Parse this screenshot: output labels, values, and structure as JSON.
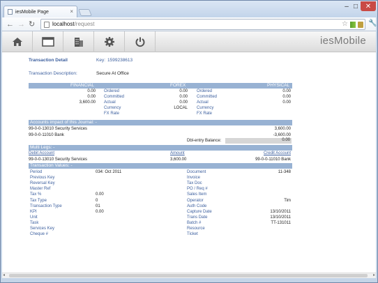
{
  "browser": {
    "tab_title": "iesMobile Page",
    "url_host": "localhost",
    "url_path": "/request"
  },
  "app": {
    "brand": "iesMobile",
    "toolbar_icons": [
      "home-icon",
      "window-icon",
      "building-icon",
      "gear-icon",
      "power-icon"
    ]
  },
  "transaction": {
    "detail_label": "Transaction Detail",
    "key_label": "Key:",
    "key_value": "1599238613",
    "desc_label": "Transaction Description:",
    "desc_value": "Secure At Office"
  },
  "currency_table": {
    "headers": [
      "FINANCIAL",
      "FOREX",
      "PHYSICAL"
    ],
    "rows": [
      {
        "fin_value": "0.00",
        "fin_label": "Ordered",
        "fx_value": "0.00",
        "fx_label": "Ordered",
        "phys_value": "0.00"
      },
      {
        "fin_value": "0.00",
        "fin_label": "Committed",
        "fx_value": "0.00",
        "fx_label": "Committed",
        "phys_value": "0.00"
      },
      {
        "fin_value": "3,600.00",
        "fin_label": "Actual",
        "fx_value": "0.00",
        "fx_label": "Actual",
        "phys_value": "0.00"
      },
      {
        "fin_value": "",
        "fin_label": "Currency",
        "fx_value": "LOCAL",
        "fx_label": "Currency",
        "phys_value": ""
      },
      {
        "fin_value": "",
        "fin_label": "FX Rate",
        "fx_value": "",
        "fx_label": "FX Rate",
        "phys_value": ""
      }
    ]
  },
  "accounts_impact": {
    "header": "Accounts impact of this Journal: -",
    "rows": [
      {
        "account": "99-0-0-13010 Security Services",
        "amount": "3,600.00"
      },
      {
        "account": "99-0-0-11010 Bank",
        "amount": "-3,600.00"
      }
    ],
    "dbl_label": "Dbl-entry Balance:",
    "dbl_value": "0.00"
  },
  "multi_legs": {
    "header": "Multi Legs: -",
    "columns": [
      "Debit Account",
      "Amount",
      "Credit Account"
    ],
    "rows": [
      {
        "debit": "99-0-0-13010 Security Services",
        "amount": "3,600.00",
        "credit": "99-0-0-11010 Bank"
      }
    ]
  },
  "transaction_values": {
    "header": "Transaction Values: -",
    "left": [
      {
        "label": "Period",
        "value": "034: Oct 2011"
      },
      {
        "label": "Previous Key",
        "value": ""
      },
      {
        "label": "Reversal Key",
        "value": ""
      },
      {
        "label": "Master Ref",
        "value": ""
      },
      {
        "label": "Tax %",
        "value": "0.00"
      },
      {
        "label": "Tax Type",
        "value": "0"
      },
      {
        "label": "Transaction Type",
        "value": "01"
      },
      {
        "label": "KPI",
        "value": "0.00"
      },
      {
        "label": "Unit",
        "value": ""
      },
      {
        "label": "Task",
        "value": ""
      },
      {
        "label": "Services Key",
        "value": ""
      },
      {
        "label": "Cheque #",
        "value": ""
      }
    ],
    "right": [
      {
        "label": "Document",
        "value": "11-348"
      },
      {
        "label": "Invoice",
        "value": ""
      },
      {
        "label": "Tax Doc",
        "value": ""
      },
      {
        "label": "PO / Req #",
        "value": ""
      },
      {
        "label": "Sales Item",
        "value": ""
      },
      {
        "label": "Operator",
        "value": "Tim"
      },
      {
        "label": "Auth Code",
        "value": ""
      },
      {
        "label": "Capture Date",
        "value": "13/10/2011"
      },
      {
        "label": "Trans Date",
        "value": "13/10/2011"
      },
      {
        "label": "Batch #",
        "value": "TT-131011"
      },
      {
        "label": "Resource",
        "value": ""
      },
      {
        "label": "Ticket",
        "value": ""
      }
    ]
  },
  "colors": {
    "band": "#98b2d3",
    "label_blue": "#3c5f9e",
    "close_red": "#c94a45"
  }
}
